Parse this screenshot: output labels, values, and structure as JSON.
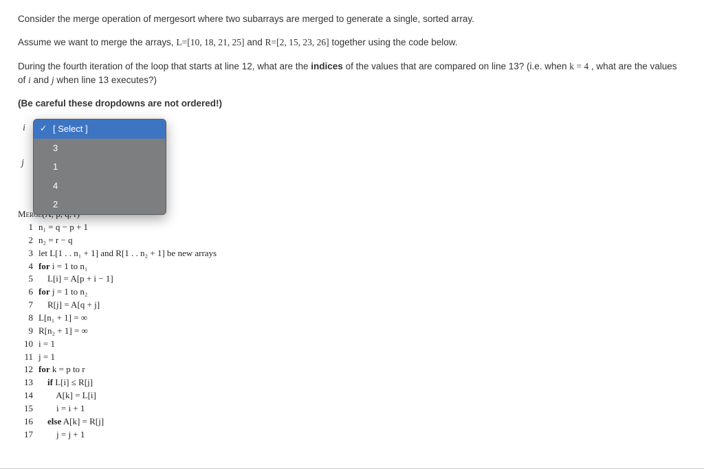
{
  "question": {
    "p1_a": "Consider the merge operation of mergesort where two subarrays are merged to generate a single, sorted array.",
    "p2_a": "Assume we want to merge the arrays, ",
    "p2_L": "L=[10, 18, 21, 25]",
    "p2_mid": " and ",
    "p2_R": "R=[2, 15, 23, 26]",
    "p2_b": " together using the code below.",
    "p3_a": "During the fourth iteration of the loop that starts at line 12, what are the ",
    "p3_bold": "indices",
    "p3_b": " of the values that are compared on line 13? (i.e. when ",
    "p3_eq": "k = 4",
    "p3_c": " , what are the values of ",
    "p3_var_i": "i",
    "p3_d": " and ",
    "p3_var_j": "j",
    "p3_e": "  when line 13 executes?)",
    "p4_bold": "(Be careful these dropdowns are not ordered!)"
  },
  "labels": {
    "i": "i",
    "j": "j"
  },
  "dropdown": {
    "placeholder": "[ Select ]",
    "options": [
      "3",
      "1",
      "4",
      "2"
    ]
  },
  "code": {
    "title": "Merge",
    "args": "(A, p, q, r)",
    "lines": [
      {
        "n": "1",
        "t": "n₁ = q − p + 1"
      },
      {
        "n": "2",
        "t": "n₂ = r − q"
      },
      {
        "n": "3",
        "t": "let L[1 . . n₁ + 1] and R[1 . . n₂ + 1] be new arrays"
      },
      {
        "n": "4",
        "t": "for i = 1 to n₁",
        "kw": true
      },
      {
        "n": "5",
        "t": "    L[i] = A[p + i − 1]"
      },
      {
        "n": "6",
        "t": "for j = 1 to n₂",
        "kw": true
      },
      {
        "n": "7",
        "t": "    R[j] = A[q + j]"
      },
      {
        "n": "8",
        "t": "L[n₁ + 1] = ∞"
      },
      {
        "n": "9",
        "t": "R[n₂ + 1] = ∞"
      },
      {
        "n": "10",
        "t": "i = 1"
      },
      {
        "n": "11",
        "t": "j = 1"
      },
      {
        "n": "12",
        "t": "for k = p to r",
        "kw": true
      },
      {
        "n": "13",
        "t": "    if L[i] ≤ R[j]",
        "kw": true
      },
      {
        "n": "14",
        "t": "        A[k] = L[i]"
      },
      {
        "n": "15",
        "t": "        i = i + 1"
      },
      {
        "n": "16",
        "t": "    else A[k] = R[j]",
        "kw": true
      },
      {
        "n": "17",
        "t": "        j = j + 1"
      }
    ]
  }
}
